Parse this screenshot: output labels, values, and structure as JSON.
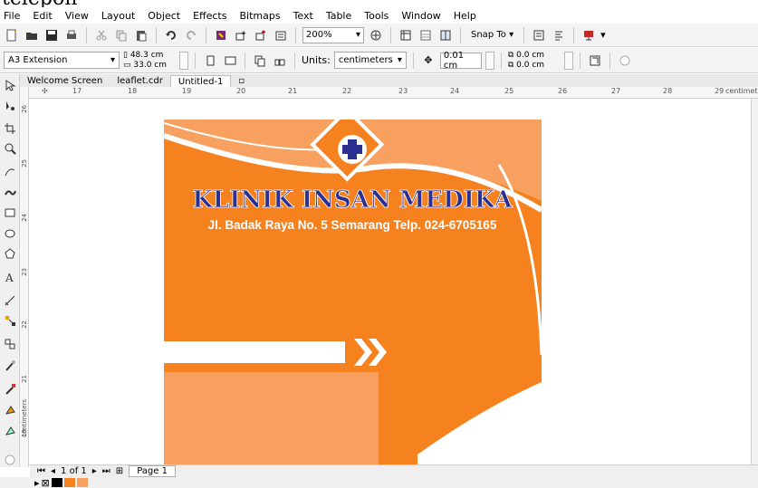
{
  "background_text": "telepon",
  "menu": [
    "File",
    "Edit",
    "View",
    "Layout",
    "Object",
    "Effects",
    "Bitmaps",
    "Text",
    "Table",
    "Tools",
    "Window",
    "Help"
  ],
  "toolbar": {
    "zoom": "200%",
    "snap_label": "Snap To"
  },
  "property_bar": {
    "page_size": "A3 Extension",
    "width": "48.3 cm",
    "height": "33.0 cm",
    "units_label": "Units:",
    "units_value": "centimeters",
    "nudge": "0.01 cm",
    "dup_x": "0.0 cm",
    "dup_y": "0.0 cm"
  },
  "tabs": [
    "Welcome Screen",
    "leaflet.cdr",
    "Untitled-1"
  ],
  "ruler": {
    "h_ticks": [
      "17",
      "18",
      "19",
      "20",
      "21",
      "22",
      "23",
      "24",
      "25",
      "26",
      "27",
      "28",
      "29"
    ],
    "h_unit": "centimeters",
    "v_ticks": [
      "26",
      "25",
      "24",
      "23",
      "22",
      "21",
      "20",
      "19"
    ],
    "v_unit": "centimeters"
  },
  "design": {
    "title": "KLINIK INSAN MEDIKA",
    "address": "Jl. Badak Raya No. 5 Semarang Telp. 024-6705165",
    "colors": {
      "orange": "#f5821f",
      "light_orange": "#f7a060",
      "navy": "#2b2f8f"
    }
  },
  "status": {
    "page_count": "1 of 1",
    "page_tab": "Page 1"
  },
  "palette": [
    "#000000",
    "#f5821f",
    "#f7a060"
  ]
}
